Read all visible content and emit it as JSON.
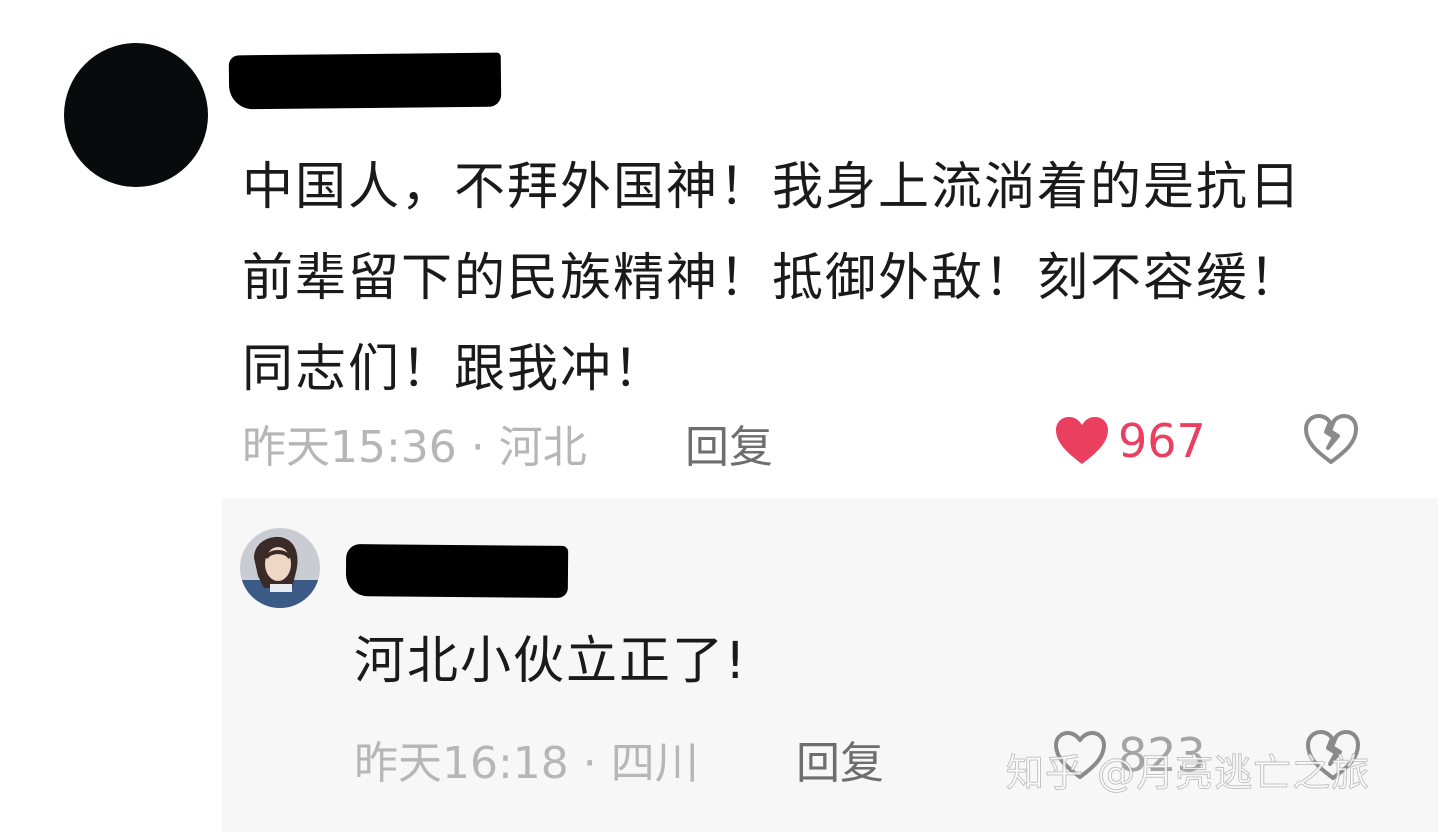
{
  "theme": {
    "accent_like": "#ea3f5e",
    "meta_color": "#b6b6b6",
    "reply_bg": "#f7f7f8"
  },
  "comment": {
    "text": "中国人，不拜外国神！我身上流淌着的是抗日前辈留下的民族精神！抵御外敌！刻不容缓！同志们！跟我冲！",
    "time_location": "昨天15:36 · 河北",
    "reply_label": "回复",
    "like_count": "967",
    "liked": true,
    "like_icon": "heart-filled-icon",
    "dislike_icon": "broken-heart-icon"
  },
  "reply": {
    "text": "河北小伙立正了!",
    "time_location": "昨天16:18 · 四川",
    "reply_label": "回复",
    "like_count": "823",
    "liked": false,
    "like_icon": "heart-outline-icon",
    "dislike_icon": "broken-heart-icon"
  },
  "watermark": {
    "text": "知乎 @月亮逃亡之旅"
  }
}
